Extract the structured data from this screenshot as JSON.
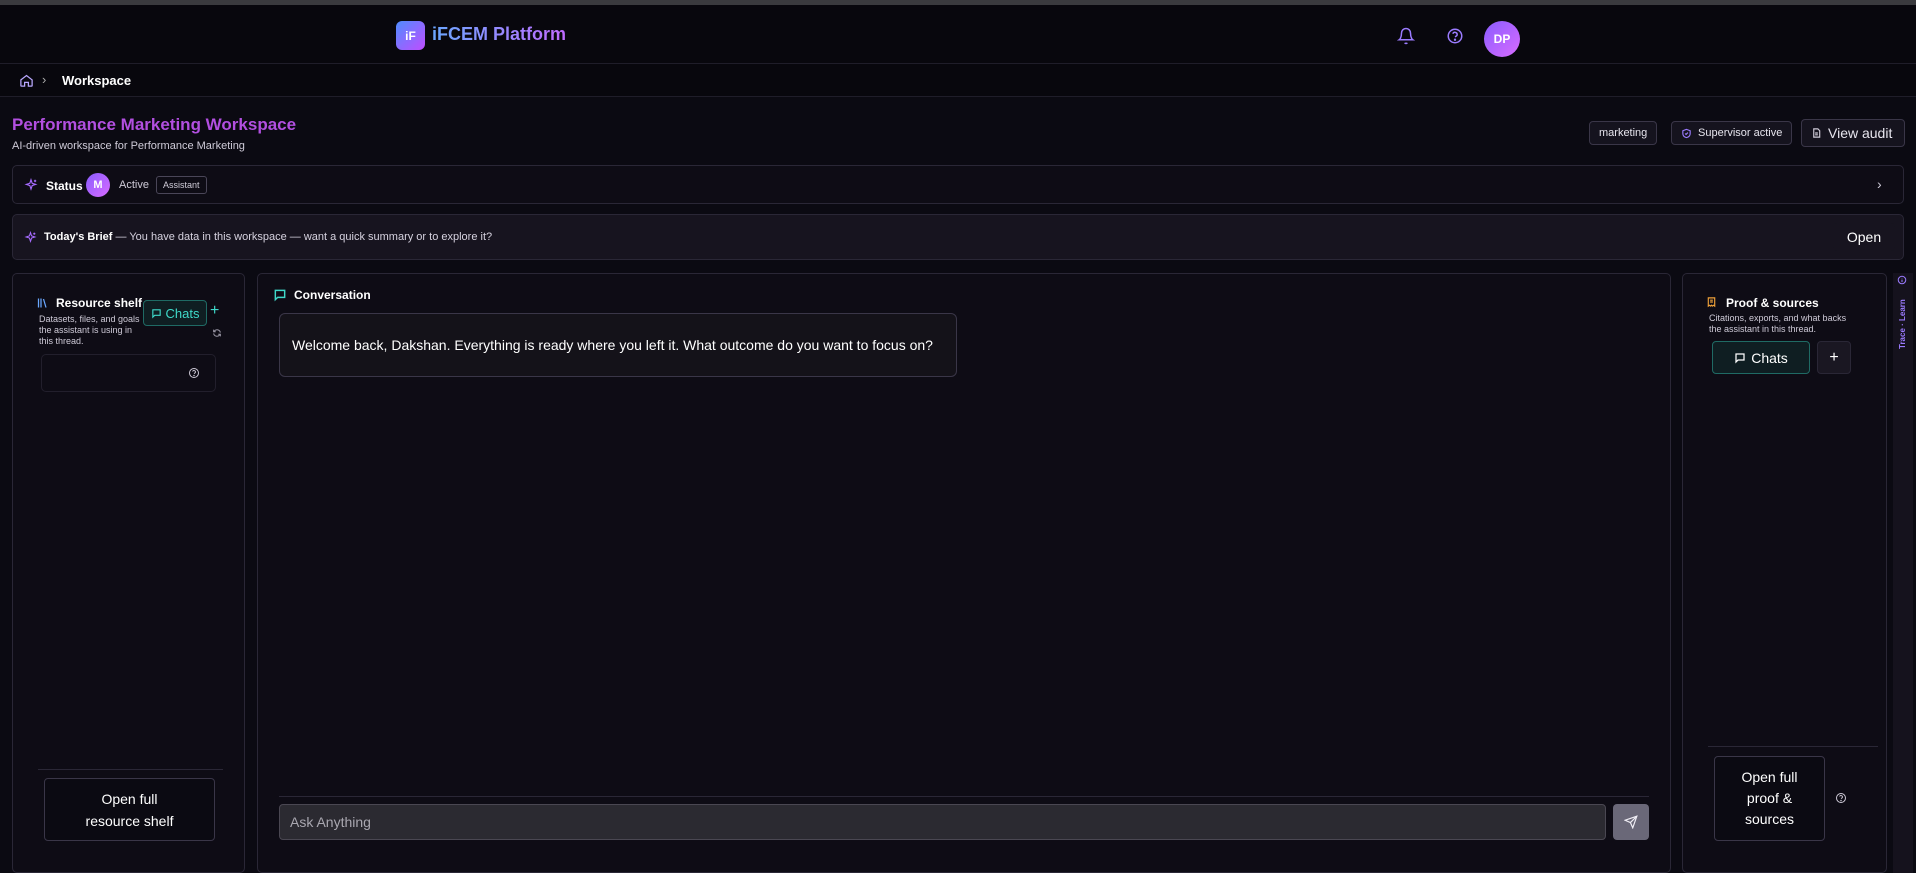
{
  "header": {
    "logo_mark": "iF",
    "app_name": "iFCEM Platform",
    "avatar_initials": "DP"
  },
  "breadcrumb": {
    "current": "Workspace"
  },
  "page": {
    "title": "Performance Marketing Workspace",
    "subtitle": "AI-driven workspace for Performance Marketing",
    "tag": "marketing",
    "supervisor": "Supervisor active",
    "audit_label": "View audit"
  },
  "status": {
    "label": "Status",
    "avatar_letter": "M",
    "state": "Active",
    "role_badge": "Assistant"
  },
  "brief": {
    "title": "Today's Brief",
    "text": " — You have data in this workspace — want a quick summary or to explore it?",
    "open_label": "Open"
  },
  "resource_shelf": {
    "title": "Resource shelf",
    "description": "Datasets, files, and goals the assistant is using in this thread.",
    "chats_label": "Chats",
    "add_label": "+",
    "open_full_label": "Open full resource shelf"
  },
  "conversation": {
    "title": "Conversation",
    "welcome_message": "Welcome back, Dakshan. Everything is ready where you left it. What outcome do you want to focus on?",
    "input_placeholder": "Ask Anything"
  },
  "proof": {
    "title": "Proof & sources",
    "description": "Citations, exports, and what backs the assistant in this thread.",
    "chats_label": "Chats",
    "add_label": "+",
    "open_full_label": "Open full proof & sources"
  },
  "rail": {
    "label": "Trace · Learn"
  },
  "colors": {
    "accent_purple": "#b24fe0",
    "teal": "#3fd9c9",
    "orange": "#f0a23a",
    "background": "#0b0a12"
  }
}
